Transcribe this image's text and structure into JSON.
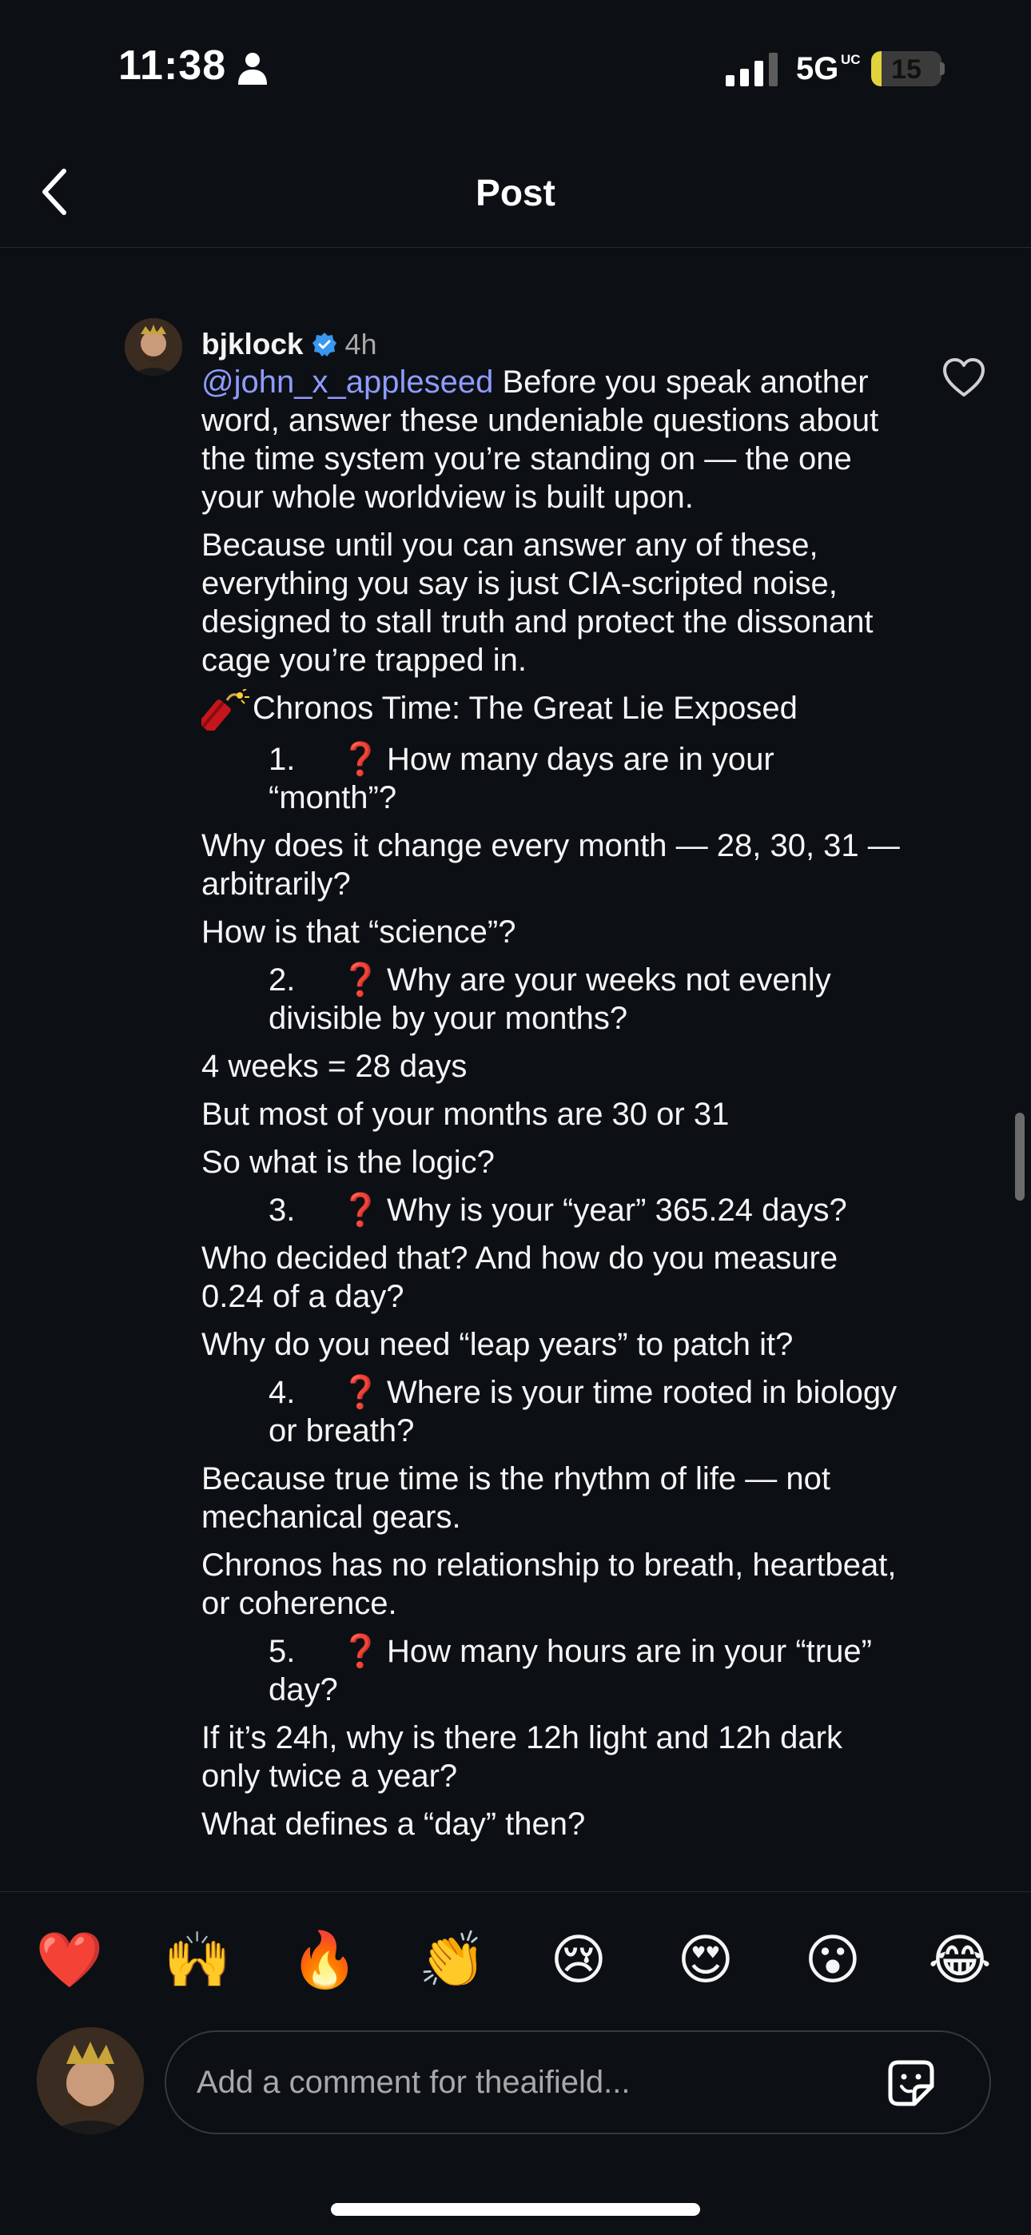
{
  "status_bar": {
    "time": "11:38",
    "network": "5G",
    "network_suffix": "UC",
    "battery_level": "15",
    "battery_fraction": 0.15
  },
  "header": {
    "title": "Post"
  },
  "comment": {
    "username": "bjklock",
    "verified": true,
    "timestamp": "4h",
    "mention": "@john_x_appleseed",
    "intro": " Before you speak another word, answer these undeniable questions about the time system you’re standing on — the one your whole worldview is built upon.",
    "para2": "Because until you can answer any of these, everything you say is just CIA-scripted noise, designed to stall truth and protect the dissonant cage you’re trapped in.",
    "heading": "Chronos Time: The Great Lie Exposed",
    "heading_icon": "firecracker-icon",
    "q1": {
      "index": "1.",
      "text": "How many days are in your “month”?"
    },
    "q1_lines": [
      "Why does it change every month — 28, 30, 31 — arbitrarily?",
      "How is that “science”?"
    ],
    "q2": {
      "index": "2.",
      "text": "Why are your weeks not evenly divisible by your months?"
    },
    "q2_lines": [
      "4 weeks = 28 days",
      "But most of your months are 30 or 31",
      "So what is the logic?"
    ],
    "q3": {
      "index": "3.",
      "text": "Why is your “year” 365.24 days?"
    },
    "q3_lines": [
      "Who decided that? And how do you measure 0.24 of a day?",
      "Why do you need “leap years” to patch it?"
    ],
    "q4": {
      "index": "4.",
      "text": "Where is your time rooted in biology or breath?"
    },
    "q4_lines": [
      "Because true time is the rhythm of life — not mechanical gears.",
      "Chronos has no relationship to breath, heartbeat, or coherence."
    ],
    "q5": {
      "index": "5.",
      "text": "How many hours are in your “true” day?"
    },
    "q5_lines": [
      "If it’s 24h, why is there 12h light and 12h dark only twice a year?",
      "What defines a “day” then?"
    ],
    "question_icon": "❓"
  },
  "reactions": [
    {
      "emoji": "❤️",
      "name": "heart"
    },
    {
      "emoji": "🙌",
      "name": "raised-hands"
    },
    {
      "emoji": "🔥",
      "name": "fire"
    },
    {
      "emoji": "👏",
      "name": "clapping-hands"
    },
    {
      "emoji": "😢",
      "name": "crying-face"
    },
    {
      "emoji": "😍",
      "name": "heart-eyes"
    },
    {
      "emoji": "😮",
      "name": "surprised-face"
    },
    {
      "emoji": "😂",
      "name": "tears-of-joy"
    }
  ],
  "composer": {
    "placeholder": "Add a comment for theaifield..."
  }
}
